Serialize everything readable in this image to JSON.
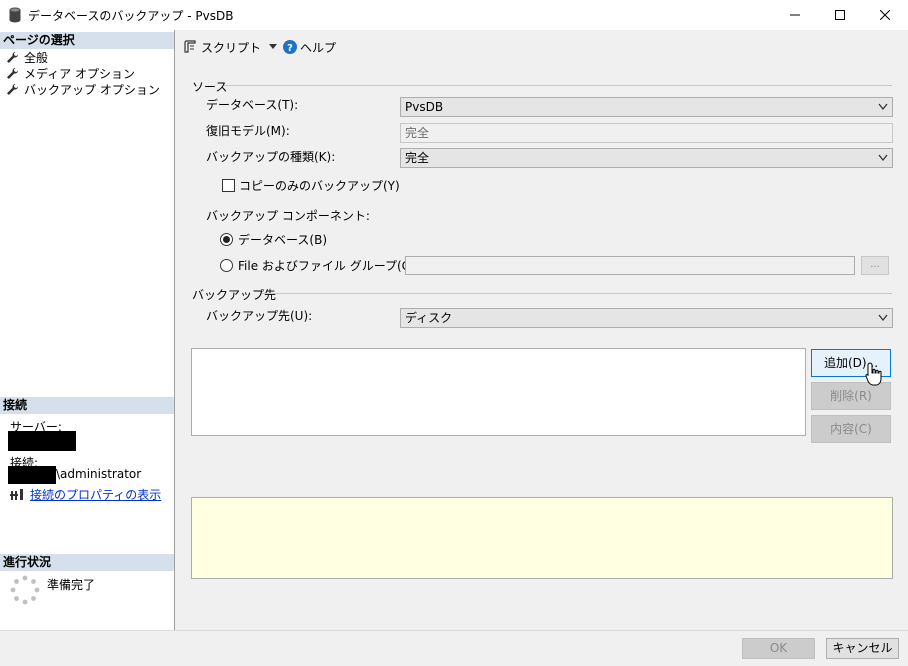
{
  "window": {
    "title": "データベースのバックアップ - PvsDB",
    "icons": {
      "app": "database-icon",
      "minimize": "minimize-icon",
      "maximize": "maximize-icon",
      "close": "close-icon"
    }
  },
  "left": {
    "pages_header": "ページの選択",
    "pages": [
      {
        "label": "全般",
        "icon": "wrench-icon"
      },
      {
        "label": "メディア オプション",
        "icon": "wrench-icon"
      },
      {
        "label": "バックアップ オプション",
        "icon": "wrench-icon"
      }
    ],
    "connection_header": "接続",
    "server_label": "サーバー:",
    "connection_label": "接続:",
    "connection_user_suffix": "\\administrator",
    "connection_link": "接続のプロパティの表示",
    "progress_header": "進行状況",
    "progress_status": "準備完了"
  },
  "toolbar": {
    "script_label": "スクリプト",
    "help_label": "ヘルプ"
  },
  "source": {
    "group_label": "ソース",
    "database_label": "データベース(T):",
    "database_value": "PvsDB",
    "recovery_label": "復旧モデル(M):",
    "recovery_value": "完全",
    "type_label": "バックアップの種類(K):",
    "type_value": "完全",
    "copy_only_label": "コピーのみのバックアップ(Y)",
    "component_label": "バックアップ コンポーネント:",
    "component_database": "データベース(B)",
    "component_files": "File およびファイル グループ(G):",
    "browse_label": "..."
  },
  "destination": {
    "group_label": "バックアップ先",
    "dest_label": "バックアップ先(U):",
    "dest_value": "ディスク",
    "add_button": "追加(D)...",
    "remove_button": "削除(R)",
    "contents_button": "内容(C)"
  },
  "footer": {
    "ok": "OK",
    "cancel": "キャンセル"
  },
  "colors": {
    "section_header_bg": "#d6e0ec",
    "message_bg": "#ffffe1",
    "link": "#0033cc",
    "accent_border": "#0078d7"
  }
}
